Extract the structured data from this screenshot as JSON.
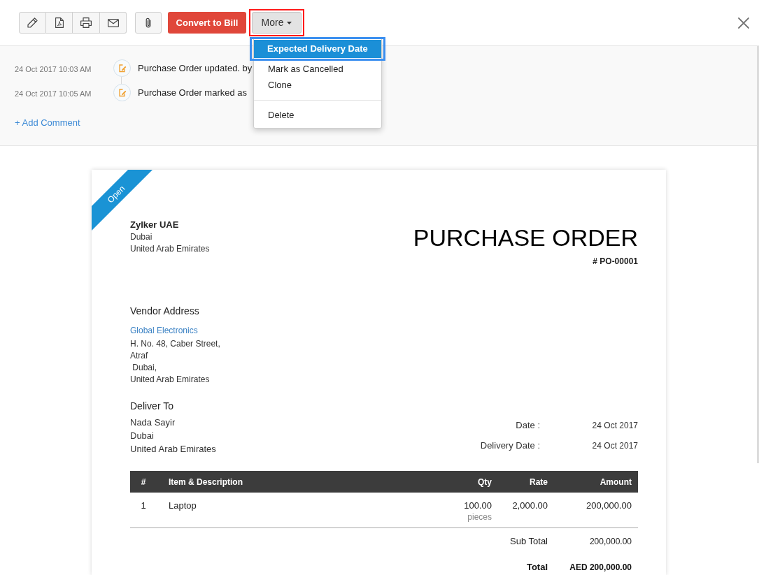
{
  "toolbar": {
    "convert_button": {
      "label": "Convert to Bill"
    },
    "more_button": {
      "label": "More",
      "expanded": true,
      "outlined": true
    }
  },
  "more_menu": {
    "groups": [
      {
        "items": [
          {
            "label": "Expected Delivery Date",
            "selected": true,
            "outlined": true
          },
          {
            "label": "Mark as Cancelled",
            "selected": false,
            "outlined": false
          },
          {
            "label": "Clone",
            "selected": false,
            "outlined": false
          }
        ]
      },
      {
        "items": [
          {
            "label": "Delete",
            "selected": false,
            "outlined": false
          }
        ]
      }
    ]
  },
  "activity": {
    "entries": [
      {
        "time": "24 Oct 2017 10:03 AM",
        "text": "Purchase Order updated. by"
      },
      {
        "time": "24 Oct 2017 10:05 AM",
        "text": "Purchase Order marked as"
      }
    ],
    "add_comment": "+ Add Comment"
  },
  "document": {
    "status": "Open",
    "company": {
      "name": "Zylker UAE",
      "address": [
        "Dubai",
        "United Arab Emirates"
      ]
    },
    "title": "PURCHASE ORDER",
    "number": "# PO-00001",
    "vendor": {
      "heading": "Vendor Address",
      "name": "Global Electronics",
      "address": [
        "H. No. 48, Caber Street,",
        "Atraf",
        " Dubai,",
        "United Arab Emirates"
      ]
    },
    "deliver_to": {
      "heading": "Deliver To",
      "address": [
        "Nada Sayir",
        "Dubai",
        "United Arab Emirates"
      ]
    },
    "details": [
      {
        "label": "Date :",
        "value": "24 Oct 2017"
      },
      {
        "label": "Delivery Date :",
        "value": "24 Oct 2017"
      }
    ],
    "table": {
      "columns": [
        "#",
        "Item & Description",
        "Qty",
        "Rate",
        "Amount"
      ],
      "rows": [
        {
          "number": "1",
          "item": "Laptop",
          "qty": "100.00",
          "unit": "pieces",
          "rate": "2,000.00",
          "amount": "200,000.00"
        }
      ]
    },
    "totals": [
      {
        "kind": "subtotal",
        "label": "Sub Total",
        "value": "200,000.00"
      },
      {
        "kind": "total",
        "label": "Total",
        "value": "AED 200,000.00"
      }
    ]
  }
}
